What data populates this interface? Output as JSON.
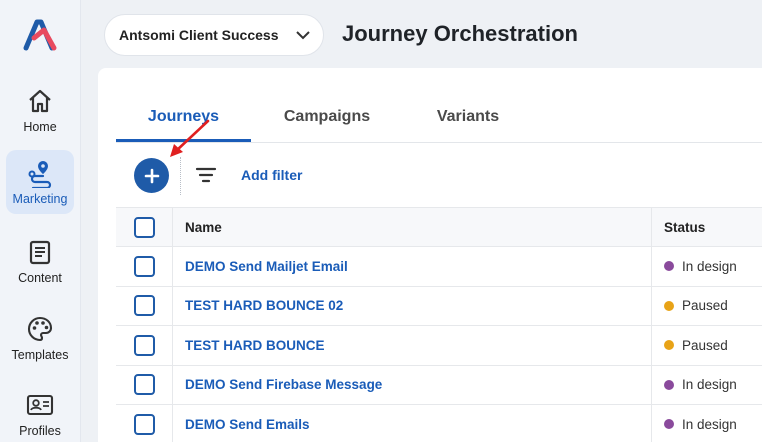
{
  "nav": {
    "items": [
      {
        "label": "Home",
        "icon": "home-icon"
      },
      {
        "label": "Marketing",
        "icon": "marketing-route-icon",
        "active": true
      },
      {
        "label": "Content",
        "icon": "content-document-icon"
      },
      {
        "label": "Templates",
        "icon": "palette-icon"
      },
      {
        "label": "Profiles",
        "icon": "profile-card-icon"
      }
    ]
  },
  "header": {
    "portal": "Antsomi Client Success",
    "title": "Journey Orchestration"
  },
  "tabs": [
    {
      "label": "Journeys",
      "active": true
    },
    {
      "label": "Campaigns"
    },
    {
      "label": "Variants"
    }
  ],
  "toolbar": {
    "add_filter": "Add filter"
  },
  "table": {
    "columns": {
      "name": "Name",
      "status": "Status"
    },
    "rows": [
      {
        "name": "DEMO Send Mailjet Email",
        "status": "In design",
        "status_color": "#8a4a9c"
      },
      {
        "name": "TEST HARD BOUNCE 02",
        "status": "Paused",
        "status_color": "#e8a317"
      },
      {
        "name": "TEST HARD BOUNCE",
        "status": "Paused",
        "status_color": "#e8a317"
      },
      {
        "name": "DEMO Send Firebase Message",
        "status": "In design",
        "status_color": "#8a4a9c"
      },
      {
        "name": "DEMO Send Emails",
        "status": "In design",
        "status_color": "#8a4a9c"
      }
    ]
  },
  "colors": {
    "primary": "#1f5ba8",
    "link": "#1a5cb8",
    "annotation_arrow": "#e02020"
  }
}
